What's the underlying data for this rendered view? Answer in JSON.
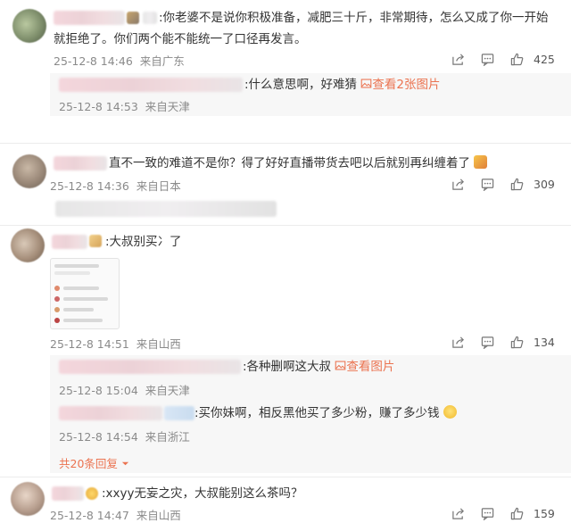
{
  "comments": [
    {
      "text_line1": ":你老婆不是说你积极准备，减肥三十斤，非常期待，怎么又成了你一开始",
      "text_line2": "就拒绝了。你们两个能不能统一了口径再发言。",
      "time": "25-12-8 14:46",
      "location": "来自广东",
      "likes": "425"
    },
    {
      "text": "直不一致的难道不是你？得了好好直播带货去吧以后就别再纠缠着了",
      "time": "25-12-8 14:36",
      "location": "来自日本",
      "likes": "309"
    },
    {
      "text": ":大叔别买冫了",
      "time": "25-12-8 14:51",
      "location": "来自山西",
      "likes": "134"
    },
    {
      "text": ":xxyy无妄之灾，大叔能别这么茶吗？",
      "time": "25-12-8 14:47",
      "location": "来自山西",
      "likes": "159"
    }
  ],
  "replies": [
    {
      "text": ":什么意思啊，好难猜",
      "pic_link": "查看2张图片",
      "time": "25-12-8 14:53",
      "location": "来自天津"
    },
    {
      "text": ":各种删啊这大叔",
      "pic_link": "查看图片",
      "time": "25-12-8 15:04",
      "location": "来自天津"
    },
    {
      "text": ":买你妹啊，相反黑他买了多少粉，赚了多少钱",
      "time": "25-12-8 14:54",
      "location": "来自浙江"
    }
  ],
  "more_replies": "共20条回复",
  "icons": {
    "share": "share-icon",
    "comment": "comment-icon",
    "like": "thumbs-up-icon",
    "picture": "picture-icon",
    "chevron": "chevron-down-icon"
  },
  "colors": {
    "link": "#eb7350",
    "meta": "#8a8a8a"
  }
}
